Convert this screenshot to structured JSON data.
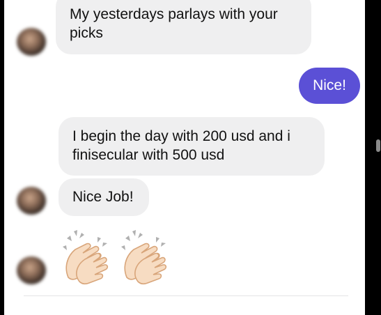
{
  "messages": [
    {
      "direction": "incoming",
      "text": "My yesterdays parlays with your picks"
    },
    {
      "direction": "outgoing",
      "text": "Nice!"
    },
    {
      "direction": "incoming",
      "text": "I begin the day with 200 usd and i finisecular with 500 usd"
    },
    {
      "direction": "incoming",
      "text": "Nice Job!"
    },
    {
      "direction": "incoming",
      "emoji": [
        "clapping-hands",
        "clapping-hands"
      ]
    }
  ],
  "colors": {
    "incoming_bubble": "#efeff0",
    "outgoing_bubble": "#5b50d6",
    "outgoing_text": "#ffffff"
  }
}
